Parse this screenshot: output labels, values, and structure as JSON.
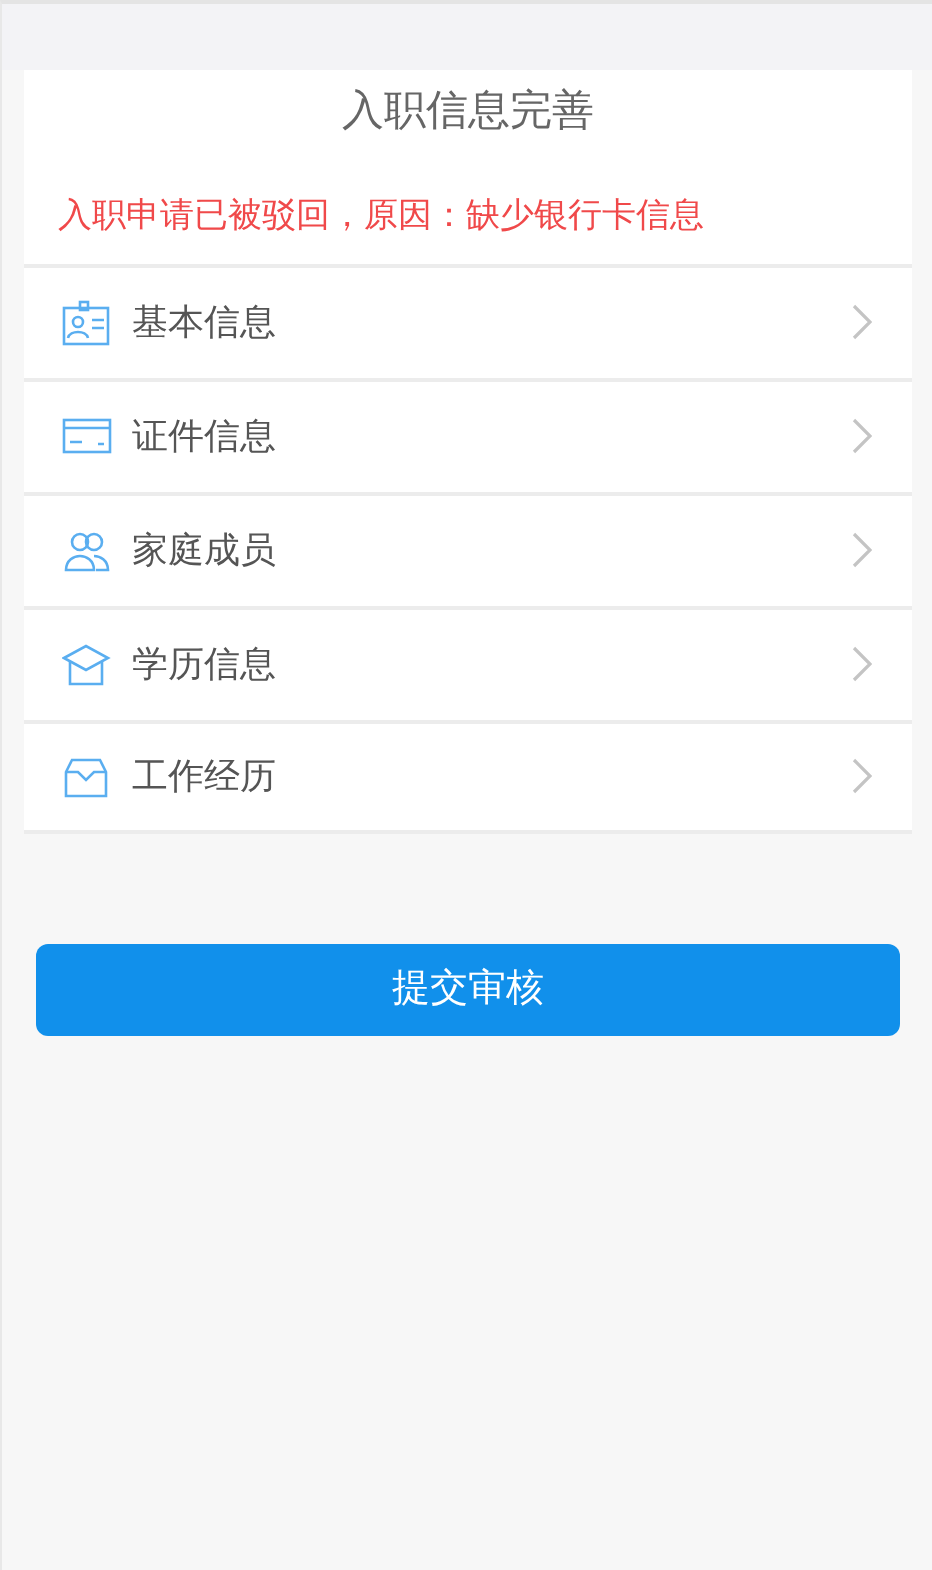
{
  "title": "入职信息完善",
  "notice": "入职申请已被驳回，原因：缺少银行卡信息",
  "items": [
    {
      "label": "基本信息"
    },
    {
      "label": "证件信息"
    },
    {
      "label": "家庭成员"
    },
    {
      "label": "学历信息"
    },
    {
      "label": "工作经历"
    }
  ],
  "submit_button": "提交审核"
}
